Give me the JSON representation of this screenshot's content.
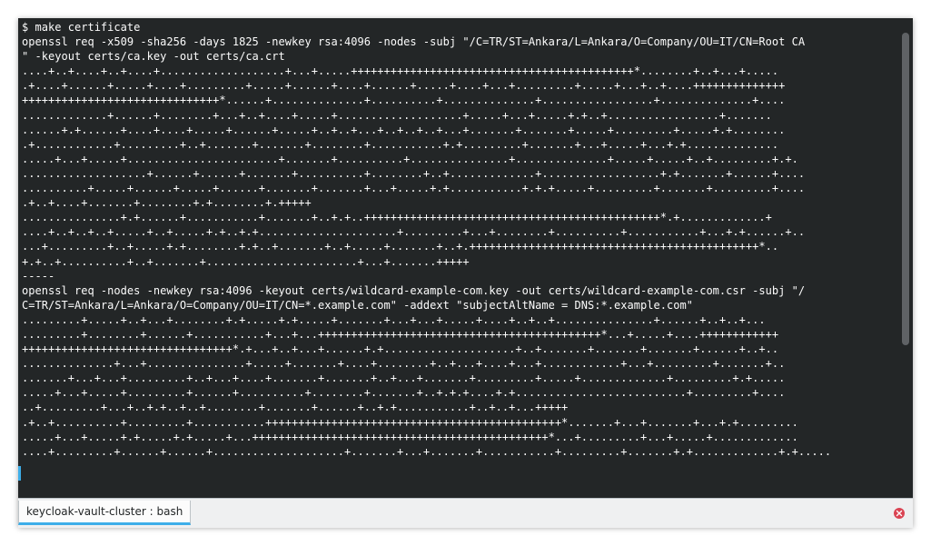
{
  "terminal": {
    "lines": [
      "$ make certificate",
      "openssl req -x509 -sha256 -days 1825 -newkey rsa:4096 -nodes -subj \"/C=TR/ST=Ankara/L=Ankara/O=Company/OU=IT/CN=Root CA",
      "\" -keyout certs/ca.key -out certs/ca.crt",
      "....+..+....+..+....+...................+...+.....+++++++++++++++++++++++++++++++++++++++++++*........+..+...+.....",
      ".+....+......+.....+....+.........+.....+......+....+......+.....+....+...+.........+.....+...+..+....++++++++++++++",
      "++++++++++++++++++++++++++++++*......+..............+..........+..............+.................+..............+....",
      ".............+......+........+...+..+....+.....+...................+.....+...+.....+.+..+.................+.......",
      "......+.+......+....+....+.....+......+.....+..+..+...+..+..+..+...+.......+.......+.....+.........+.....+.+........",
      ".+............+.........+..+.......+.......+........+...........+.+.........+.......+...+.....+...+.+..............",
      ".....+...+.....+.......................+.......+..........+...............+..............+.....+.....+..+.........+.+.",
      "...................+......+......+.......+..........+........+..+.............+..................+.+.......+......+....",
      "..........+.....+......+.....+......+.......+.......+...+.....+.+...........+.+.+.....+.........+.......+.........+....",
      ".+..+....+.......+........+.+........+.+++++",
      "...............+.+......+...........+.......+..+.+..+++++++++++++++++++++++++++++++++++++++++++++*.+.............+",
      "....+..+..+..+.....+..+.....+.+..+.+.....................+.........+...+........+..........+...........+...+.+......+..",
      "...+.........+..+.....+.+........+.+..+.......+..+.....+.......+..+.++++++++++++++++++++++++++++++++++++++++++++*..",
      "+.+..+..........+..+.......+.......................+...+.......+++++",
      "-----",
      "openssl req -nodes -newkey rsa:4096 -keyout certs/wildcard-example-com.key -out certs/wildcard-example-com.csr -subj \"/",
      "C=TR/ST=Ankara/L=Ankara/O=Company/OU=IT/CN=*.example.com\" -addext \"subjectAltName = DNS:*.example.com\"",
      ".........+.....+..+...+........+.+.....+.+.....+.......+...+...+.....+....+..+..+...............+......+..+..+...",
      ".........+........+......+...........+...+...+++++++++++++++++++++++++++++++++++++++++++*...+.....+....++++++++++++",
      "++++++++++++++++++++++++++++++++*.+...+..+...+......+.+....................+..+.......+.......+.......+......+..+..",
      "..............+...+...............+.....+.......+....+........+..+...+....+...+............+...+.........+.......+..",
      ".......+...+...+.........+..+...+....+.......+.......+..+...+.......+.........+.....+.............+.........+.+.....",
      ".....+...+.....+.........+......+..........+........+.......+..+.+.+....+.+..........................+.........+....",
      "..+.........+...+..+.+..+..+........+.......+......+..+.+...........+..+..+...+++++",
      ".+..+..........+.........+...........+++++++++++++++++++++++++++++++++++++++++++++*.......+...+.......+...+.+.........",
      ".....+...+.....+.+.....+.+.....+...+++++++++++++++++++++++++++++++++++++++++++++*...+.........+...+.....+.............",
      "....+.........+......+......+....................+.......+...+.......+...........+.........+.......+.+.............+.+....."
    ]
  },
  "tabs": [
    {
      "label": "keycloak-vault-cluster : bash"
    }
  ],
  "colors": {
    "terminal_bg": "#232627",
    "terminal_fg": "#fcfcfc",
    "accent": "#3daee9",
    "close": "#da4453"
  },
  "icons": {
    "close": "close-icon"
  }
}
